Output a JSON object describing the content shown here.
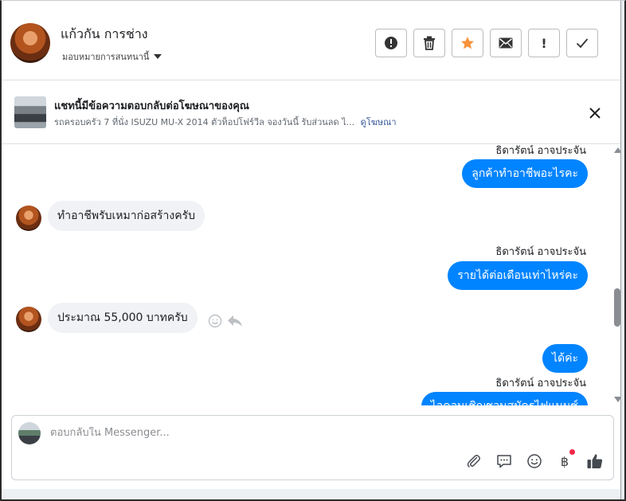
{
  "header": {
    "contact_name": "แก้วกัน การช่าง",
    "assign_label": "มอบหมายการสนทนานี้",
    "actions": [
      {
        "name": "mark-spam-button",
        "icon": "alert-circle-icon"
      },
      {
        "name": "delete-button",
        "icon": "trash-icon"
      },
      {
        "name": "star-button",
        "icon": "star-icon"
      },
      {
        "name": "mark-unread-button",
        "icon": "envelope-icon"
      },
      {
        "name": "follow-up-button",
        "icon": "exclamation-icon",
        "glyph": "!"
      },
      {
        "name": "mark-done-button",
        "icon": "check-icon"
      }
    ],
    "star_color": "#f7923b"
  },
  "ad": {
    "title": "แชทนี้มีข้อความตอบกลับต่อโฆษณาของคุณ",
    "description": "รถครอบครัว 7 ที่นั่ง ISUZU MU-X 2014 ตัวท็อปโฟร์วีล จองวันนี้ รับส่วนลด ไ...",
    "link": "ดูโฆษณา"
  },
  "messages": {
    "sender_name_1": "ธิดารัตน์ อาจประจัน",
    "out_1": "ลูกค้าทำอาชีพอะไรคะ",
    "in_1": "ทำอาชีพรับเหมาก่อสร้างครับ",
    "sender_name_2": "ธิดารัตน์ อาจประจัน",
    "out_2": "รายได้ต่อเดือนเท่าไหร่คะ",
    "in_2": "ประมาณ 55,000 บาทครับ",
    "out_3": "ได้ค่ะ",
    "sender_name_3": "ธิดารัตน์ อาจประจัน",
    "out_4_partial": "ไอคอนเชิญชวนสมัครไฟแนนซ์"
  },
  "composer": {
    "placeholder": "ตอบกลับใน Messenger...",
    "currency_symbol": "฿"
  },
  "colors": {
    "outgoing_bubble": "#0084ff",
    "incoming_bubble": "#f0f2f5",
    "link": "#385898",
    "like": "#444950"
  }
}
